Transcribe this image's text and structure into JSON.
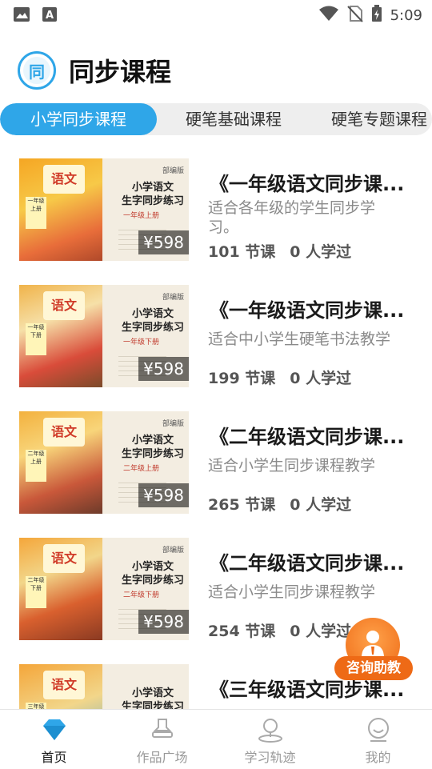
{
  "status_bar": {
    "time": "5:09",
    "icons": [
      "image-icon",
      "text-icon",
      "wifi-icon",
      "no-sim-icon",
      "battery-charging-icon"
    ]
  },
  "header": {
    "logo_char": "同",
    "title": "同步课程"
  },
  "tabs": [
    {
      "label": "小学同步课程",
      "active": true
    },
    {
      "label": "硬笔基础课程",
      "active": false
    },
    {
      "label": "硬笔专题课程",
      "active": false
    }
  ],
  "courses": [
    {
      "title": "《一年级语文同步课...",
      "description": "适合各年级的学生同步学习。",
      "lessons": "101 节课",
      "learners": "0 人学过",
      "price": "¥598",
      "cover": {
        "book": "语文",
        "edition": "部编版",
        "name": "小学语文\n生字同步练习",
        "grade": "一年级上册",
        "side": "一年级 上册"
      }
    },
    {
      "title": "《一年级语文同步课...",
      "description": "适合中小学生硬笔书法教学",
      "lessons": "199 节课",
      "learners": "0 人学过",
      "price": "¥598",
      "cover": {
        "book": "语文",
        "edition": "部编版",
        "name": "小学语文\n生字同步练习",
        "grade": "一年级下册",
        "side": "一年级 下册"
      }
    },
    {
      "title": "《二年级语文同步课...",
      "description": "适合小学生同步课程教学",
      "lessons": "265 节课",
      "learners": "0 人学过",
      "price": "¥598",
      "cover": {
        "book": "语文",
        "edition": "部编版",
        "name": "小学语文\n生字同步练习",
        "grade": "二年级上册",
        "side": "二年级 上册"
      }
    },
    {
      "title": "《二年级语文同步课...",
      "description": "适合小学生同步课程教学",
      "lessons": "254 节课",
      "learners": "0 人学过",
      "price": "¥598",
      "cover": {
        "book": "语文",
        "edition": "部编版",
        "name": "小学语文\n生字同步练习",
        "grade": "二年级下册",
        "side": "二年级 下册"
      }
    },
    {
      "title": "《三年级语文同步课...",
      "description": "",
      "lessons": "",
      "learners": "",
      "price": "",
      "cover": {
        "book": "语文",
        "edition": "",
        "name": "小学语文\n生字同步练习",
        "grade": "",
        "side": "三年级"
      }
    }
  ],
  "consult_button": {
    "label": "咨询助教"
  },
  "bottom_nav": [
    {
      "label": "首页",
      "icon": "diamond-icon",
      "active": true
    },
    {
      "label": "作品广场",
      "icon": "stamp-icon",
      "active": false
    },
    {
      "label": "学习轨迹",
      "icon": "map-pin-icon",
      "active": false
    },
    {
      "label": "我的",
      "icon": "smile-icon",
      "active": false
    }
  ],
  "colors": {
    "accent": "#2fa6e8",
    "consult": "#ee6a16",
    "tab_bg": "#eeeeee",
    "muted_text": "#8a8a8a"
  }
}
